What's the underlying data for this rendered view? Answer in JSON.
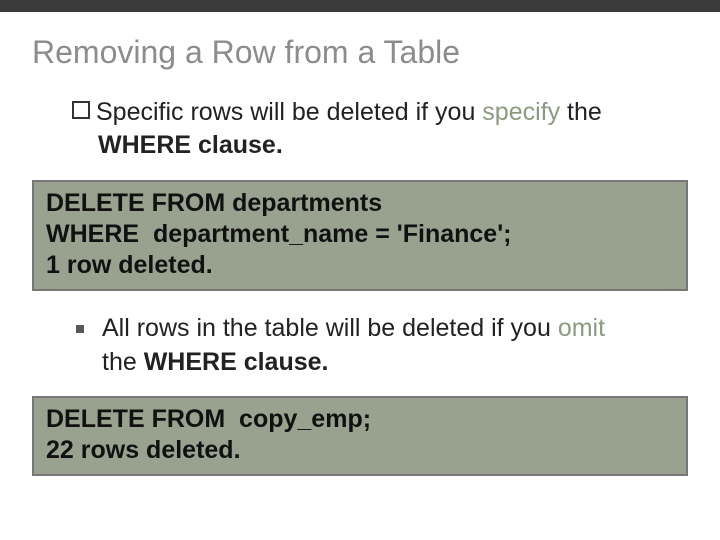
{
  "title": "Removing a Row from a Table",
  "bullet1": {
    "lead": "Specific rows will be deleted if you ",
    "specify": "specify",
    "tail": " the",
    "line2_bold": "WHERE clause."
  },
  "code1": {
    "l1": "DELETE FROM departments",
    "l2": "WHERE  department_name = 'Finance';",
    "l3": "1 row deleted."
  },
  "bullet2": {
    "lead": "All rows in the table will be deleted if you ",
    "omit": "omit",
    "line2_pre": "the ",
    "line2_bold": "WHERE clause."
  },
  "code2": {
    "l1": "DELETE FROM  copy_emp;",
    "l2": "22 rows deleted."
  }
}
